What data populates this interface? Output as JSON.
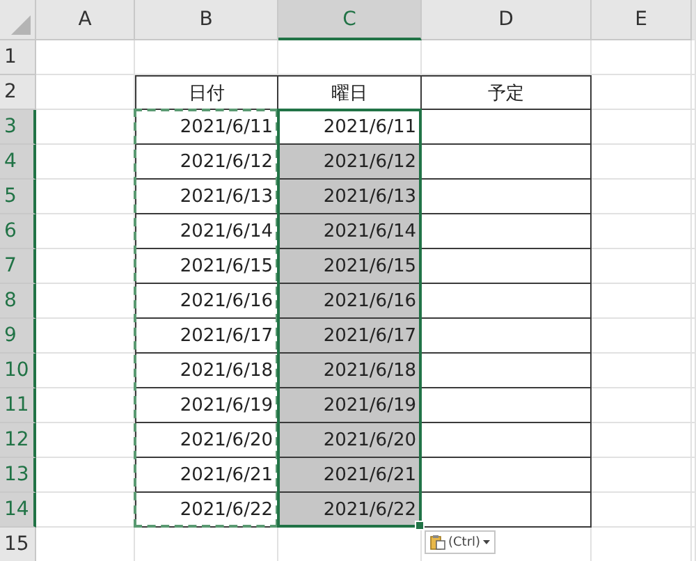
{
  "column_headers": [
    {
      "label": "A",
      "selected": false
    },
    {
      "label": "B",
      "selected": false
    },
    {
      "label": "C",
      "selected": true
    },
    {
      "label": "D",
      "selected": false
    },
    {
      "label": "E",
      "selected": false
    }
  ],
  "row_headers": [
    {
      "label": "1",
      "selected": false
    },
    {
      "label": "2",
      "selected": false
    },
    {
      "label": "3",
      "selected": true
    },
    {
      "label": "4",
      "selected": true
    },
    {
      "label": "5",
      "selected": true
    },
    {
      "label": "6",
      "selected": true
    },
    {
      "label": "7",
      "selected": true
    },
    {
      "label": "8",
      "selected": true
    },
    {
      "label": "9",
      "selected": true
    },
    {
      "label": "10",
      "selected": true
    },
    {
      "label": "11",
      "selected": true
    },
    {
      "label": "12",
      "selected": true
    },
    {
      "label": "13",
      "selected": true
    },
    {
      "label": "14",
      "selected": true
    },
    {
      "label": "15",
      "selected": false
    }
  ],
  "table": {
    "columns": [
      "日付",
      "曜日",
      "予定"
    ],
    "rows": [
      {
        "date": "2021/6/11",
        "weekday": "2021/6/11",
        "selected": false
      },
      {
        "date": "2021/6/12",
        "weekday": "2021/6/12",
        "selected": true
      },
      {
        "date": "2021/6/13",
        "weekday": "2021/6/13",
        "selected": true
      },
      {
        "date": "2021/6/14",
        "weekday": "2021/6/14",
        "selected": true
      },
      {
        "date": "2021/6/15",
        "weekday": "2021/6/15",
        "selected": true
      },
      {
        "date": "2021/6/16",
        "weekday": "2021/6/16",
        "selected": true
      },
      {
        "date": "2021/6/17",
        "weekday": "2021/6/17",
        "selected": true
      },
      {
        "date": "2021/6/18",
        "weekday": "2021/6/18",
        "selected": true
      },
      {
        "date": "2021/6/19",
        "weekday": "2021/6/19",
        "selected": true
      },
      {
        "date": "2021/6/20",
        "weekday": "2021/6/20",
        "selected": true
      },
      {
        "date": "2021/6/21",
        "weekday": "2021/6/21",
        "selected": true
      },
      {
        "date": "2021/6/22",
        "weekday": "2021/6/22",
        "selected": true
      }
    ]
  },
  "copy_marquee": true,
  "paste_options": {
    "label": "(Ctrl)"
  }
}
